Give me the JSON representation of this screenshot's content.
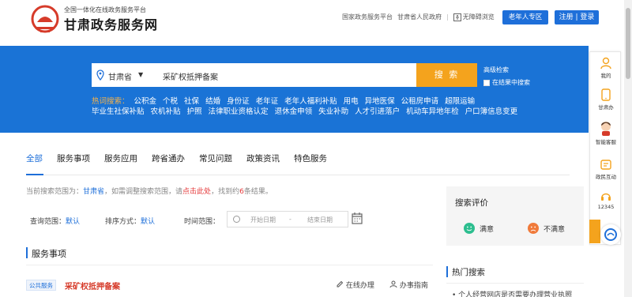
{
  "header": {
    "logo_sub": "全国一体化在线政务服务平台",
    "logo_title": "甘肃政务服务网",
    "links": [
      "国家政务服务平台",
      "甘肃省人民政府"
    ],
    "accessibility": "无障碍浏览",
    "elder_btn": "老年人专区",
    "register": "注册",
    "login": "登录",
    "login_sep": " | "
  },
  "search": {
    "location": "甘肃省",
    "query": "采矿权抵押备案",
    "button": "搜 索",
    "advanced": "高级检索",
    "in_result": "在结果中搜索"
  },
  "hot": {
    "label": "热词搜索：",
    "keywords": [
      "公积金",
      "个税",
      "社保",
      "结婚",
      "身份证",
      "老年证",
      "老年人福利补贴",
      "用电",
      "异地医保",
      "公租房申请",
      "超限运输",
      "毕业生社保补贴",
      "农机补贴",
      "护照",
      "法律职业资格认定",
      "退休金申领",
      "失业补助",
      "人才引进落户",
      "机动车异地年检",
      "户口簿信息变更"
    ]
  },
  "toolbar": {
    "items": [
      "我的",
      "甘肃办",
      "智能客服",
      "政民互动",
      "12345"
    ]
  },
  "tabs": [
    "全部",
    "服务事项",
    "服务应用",
    "跨省通办",
    "常见问题",
    "政策资讯",
    "特色服务"
  ],
  "notice": {
    "prefix": "当前搜索范围为：",
    "scope": "甘肃省",
    "middle": "，如需调整搜索范围，请",
    "link": "点击此处",
    "suffix1": "，找到约",
    "count": "6",
    "suffix2": "条结果。"
  },
  "filters": {
    "scope_label": "查询范围：",
    "scope_val": "默认",
    "sort_label": "排序方式：",
    "sort_val": "默认",
    "time_label": "时间范围：",
    "start": "开始日期",
    "dash": "-",
    "end": "结束日期"
  },
  "section": {
    "title": "服务事项"
  },
  "result": {
    "tag": "公共服务",
    "title": "采矿权抵押备案",
    "online": "在线办理",
    "guide": "办事指南"
  },
  "eval": {
    "title": "搜索评价",
    "satisfied": "满意",
    "unsatisfied": "不满意"
  },
  "hotsearch": {
    "title": "热门搜索",
    "first": "• 个人经营网店是否需要办理营业执照"
  },
  "colors": {
    "primary": "#1e6fd9",
    "banner": "#1a73d6",
    "accent": "#f4a31d",
    "red": "#d63b2a"
  }
}
